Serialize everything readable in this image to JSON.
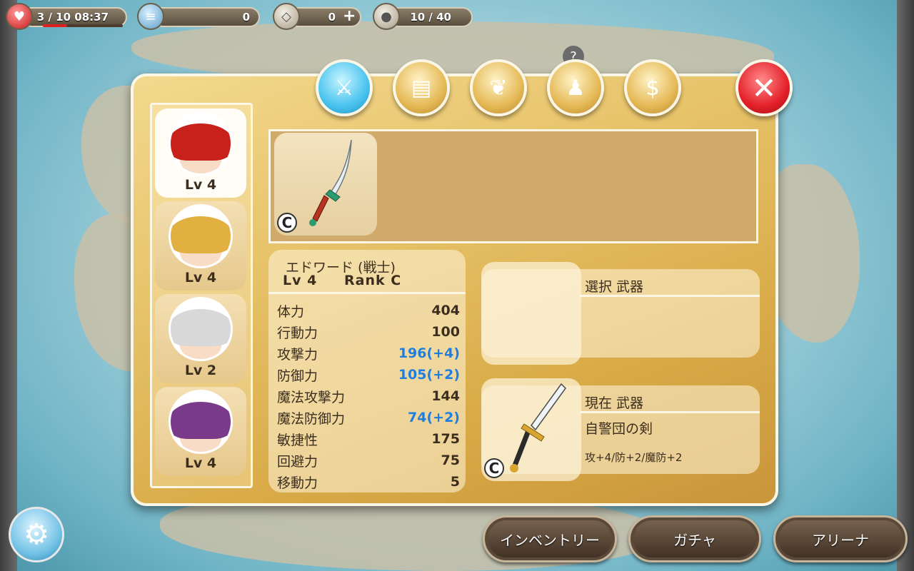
{
  "hud": {
    "stamina": "3 / 10 08:37",
    "stamina_fraction": 0.3,
    "coins": "0",
    "gems": "0",
    "inventory_count": "10 / 40"
  },
  "tabs": [
    {
      "name": "weapon",
      "icon": "sword-icon",
      "active": true
    },
    {
      "name": "armor",
      "icon": "armor-icon",
      "active": false
    },
    {
      "name": "accessory",
      "icon": "necklace-icon",
      "active": false
    },
    {
      "name": "skill",
      "icon": "aura-icon",
      "active": false
    },
    {
      "name": "item",
      "icon": "moneybag-icon",
      "active": false
    }
  ],
  "characters": [
    {
      "lv": "Lv 4",
      "hair": "#c8201a",
      "selected": true
    },
    {
      "lv": "Lv 4",
      "hair": "#e2b040",
      "selected": false
    },
    {
      "lv": "Lv 2",
      "hair": "#d8d8d8",
      "selected": false
    },
    {
      "lv": "Lv 4",
      "hair": "#7a3a8a",
      "selected": false
    }
  ],
  "item_strip": {
    "rank": "C"
  },
  "stats": {
    "name": "エドワード (戦士)",
    "lv": "Lv 4",
    "rank": "Rank C",
    "rows": [
      {
        "label": "体力",
        "value": "404",
        "bonus": false
      },
      {
        "label": "行動力",
        "value": "100",
        "bonus": false
      },
      {
        "label": "攻撃力",
        "value": "196(+4)",
        "bonus": true
      },
      {
        "label": "防御力",
        "value": "105(+2)",
        "bonus": true
      },
      {
        "label": "魔法攻撃力",
        "value": "144",
        "bonus": false
      },
      {
        "label": "魔法防御力",
        "value": "74(+2)",
        "bonus": true
      },
      {
        "label": "敏捷性",
        "value": "175",
        "bonus": false
      },
      {
        "label": "回避力",
        "value": "75",
        "bonus": false
      },
      {
        "label": "移動力",
        "value": "5",
        "bonus": false
      }
    ]
  },
  "selected_weapon": {
    "title": "選択 武器"
  },
  "current_weapon": {
    "title": "現在 武器",
    "name": "自警団の剣",
    "stats": "攻+4/防+2/魔防+2",
    "rank": "C"
  },
  "map_badge": "?",
  "bottom_buttons": {
    "inventory": "インベントリー",
    "gacha": "ガチャ",
    "arena": "アリーナ"
  }
}
